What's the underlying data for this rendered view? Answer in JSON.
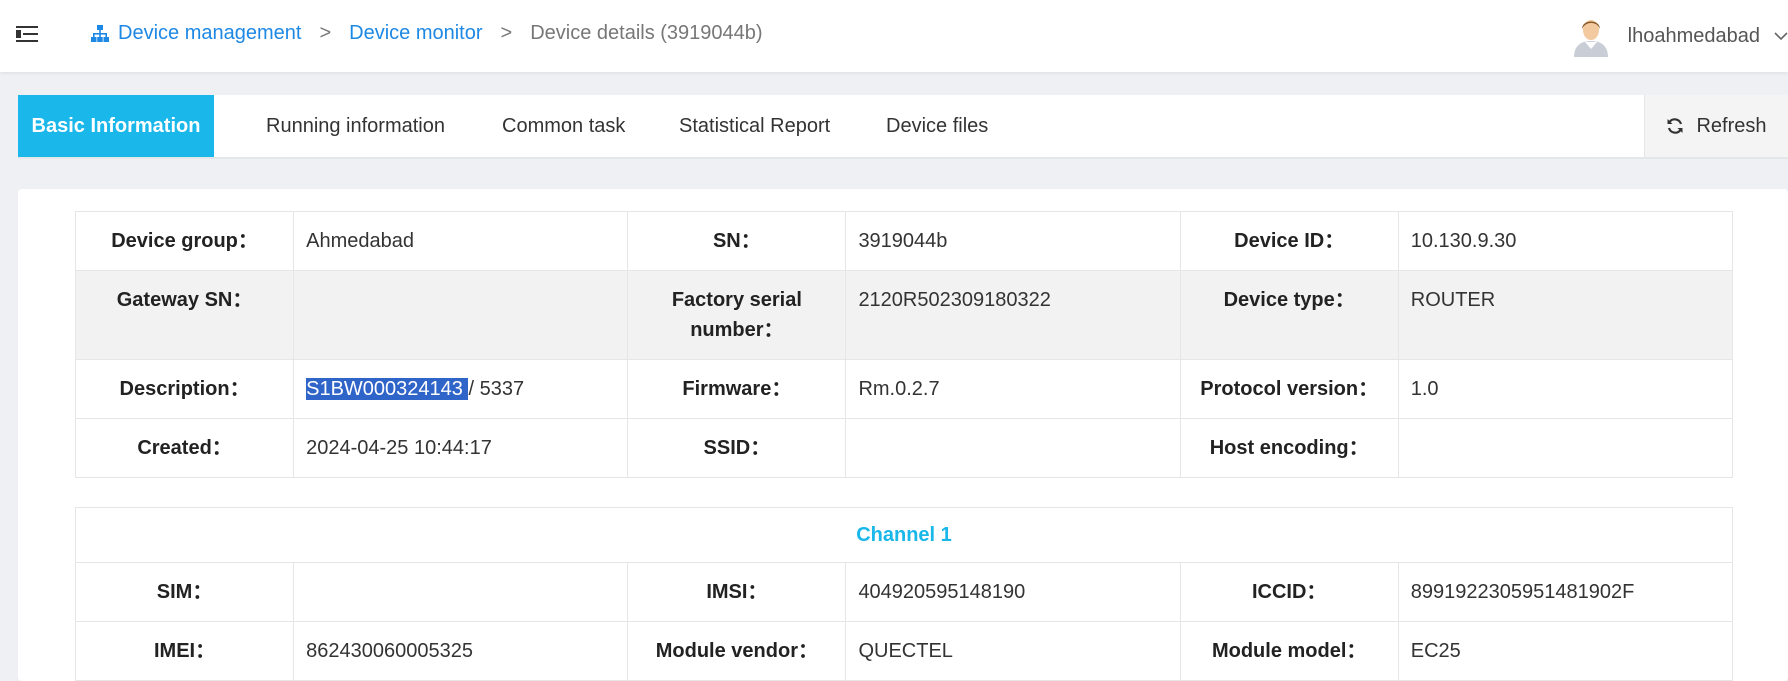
{
  "header": {
    "breadcrumb": {
      "item1": "Device management",
      "item2": "Device monitor",
      "current": "Device details (3919044b)",
      "separator": ">"
    },
    "user": {
      "name": "lhoahmedabad"
    }
  },
  "tabs": [
    {
      "label": "Basic Information",
      "active": true
    },
    {
      "label": "Running information",
      "active": false
    },
    {
      "label": "Common task",
      "active": false
    },
    {
      "label": "Statistical Report",
      "active": false
    },
    {
      "label": "Device files",
      "active": false
    }
  ],
  "refresh_label": "Refresh",
  "basic": {
    "device_group": {
      "label": "Device group：",
      "value": "Ahmedabad"
    },
    "sn": {
      "label": "SN：",
      "value": "3919044b"
    },
    "device_id": {
      "label": "Device ID：",
      "value": "10.130.9.30"
    },
    "gateway_sn": {
      "label": "Gateway SN：",
      "value": ""
    },
    "factory_serial": {
      "label": "Factory serial number：",
      "value": "2120R502309180322"
    },
    "device_type": {
      "label": "Device type：",
      "value": "ROUTER"
    },
    "description": {
      "label": "Description：",
      "value_selected": "S1BW000324143 ",
      "value_rest": "/ 5337"
    },
    "firmware": {
      "label": "Firmware：",
      "value": "Rm.0.2.7"
    },
    "protocol_version": {
      "label": "Protocol version：",
      "value": "1.0"
    },
    "created": {
      "label": "Created：",
      "value": "2024-04-25 10:44:17"
    },
    "ssid": {
      "label": "SSID：",
      "value": ""
    },
    "host_encoding": {
      "label": "Host encoding：",
      "value": ""
    }
  },
  "channel": {
    "title": "Channel 1",
    "sim": {
      "label": "SIM：",
      "value": ""
    },
    "imsi": {
      "label": "IMSI：",
      "value": "404920595148190"
    },
    "iccid": {
      "label": "ICCID：",
      "value": "8991922305951481902F"
    },
    "imei": {
      "label": "IMEI：",
      "value": "862430060005325"
    },
    "module_vendor": {
      "label": "Module vendor：",
      "value": "QUECTEL"
    },
    "module_model": {
      "label": "Module model：",
      "value": "EC25"
    }
  },
  "colors": {
    "accent": "#1ab7ea",
    "link": "#1e88e5",
    "selection": "#2f64c9"
  }
}
